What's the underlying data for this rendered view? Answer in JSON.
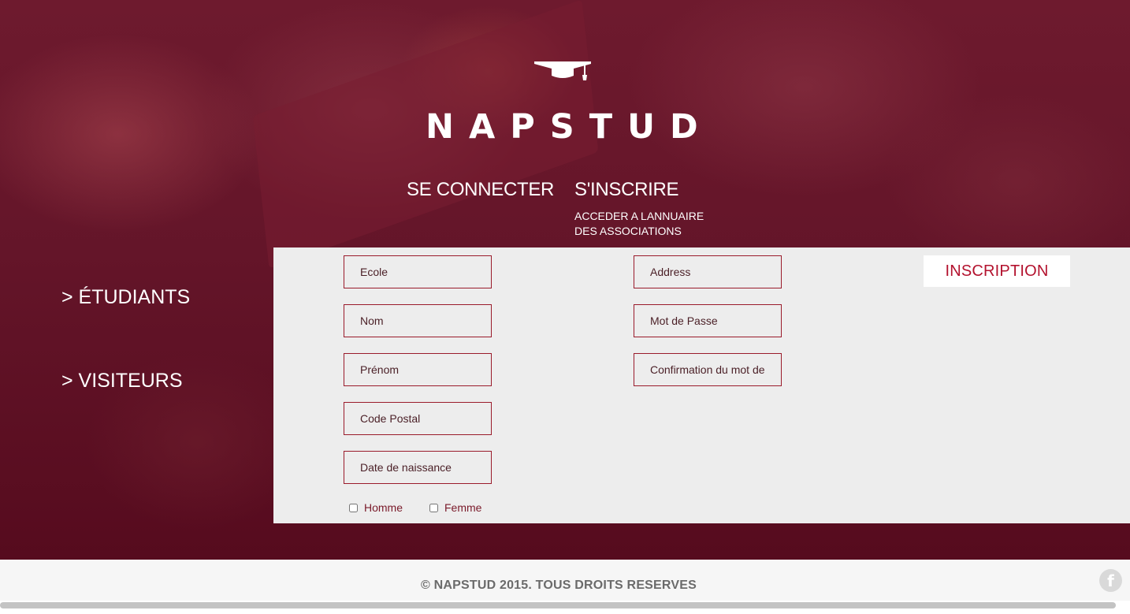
{
  "brand": {
    "name": "NAPSTUD"
  },
  "nav": {
    "login": "SE CONNECTER",
    "signup": "S'INSCRIRE",
    "annuaire_line1": "ACCEDER A LANNUAIRE",
    "annuaire_line2": "DES ASSOCIATIONS"
  },
  "sidebar": {
    "etudiants": "> ÉTUDIANTS",
    "visiteurs": "> VISITEURS"
  },
  "form": {
    "ecole": "Ecole",
    "nom": "Nom",
    "prenom": "Prénom",
    "code_postal": "Code Postal",
    "date_naissance": "Date de naissance",
    "address": "Address",
    "mot_de_passe": "Mot de Passe",
    "confirmation": "Confirmation du mot de passe",
    "homme": "Homme",
    "femme": "Femme",
    "submit": "INSCRIPTION"
  },
  "footer": {
    "copyright": "© NAPSTUD 2015. TOUS DROITS RESERVES",
    "facebook_icon": "facebook-icon",
    "facebook_glyph": "f"
  },
  "colors": {
    "accent": "#9a1b2b",
    "button_text": "#b3122e",
    "hero_bg": "#641529",
    "panel_bg": "#ededed"
  }
}
